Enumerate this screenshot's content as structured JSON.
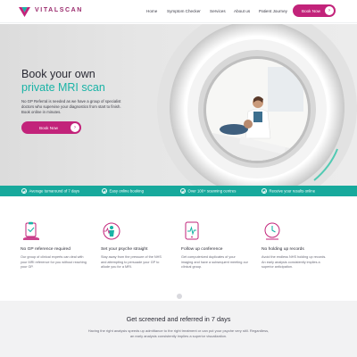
{
  "brand": {
    "name": "VITALSCAN"
  },
  "nav": {
    "items": [
      "Home",
      "Symptom Checker",
      "Services",
      "About us",
      "Patient Journey"
    ],
    "book_label": "Book Now",
    "arrow": "›"
  },
  "hero": {
    "title_line1": "Book your own",
    "title_line2": "private MRI scan",
    "description": "No GP Referral is needed as we have a group of specialist doctors who supervise your diagnostics from start to finish. Book online in minutes.",
    "cta_label": "Book Now"
  },
  "features": [
    "Average turnaround of 7 days",
    "Easy online booking",
    "Over 100+ scanning centres",
    "Receive your results online"
  ],
  "services": [
    {
      "icon": "clipboard-checkmark-icon",
      "title": "No GP reference required",
      "text": "Our group of clinical experts can deal with your MRI reference for you without reaching your GP."
    },
    {
      "icon": "body-scan-monitor-icon",
      "title": "Set your psyche straight",
      "text": "Stay away from the pressure of the NHS and attempting to persuade your GP to allude you for a MRI."
    },
    {
      "icon": "tablet-heartbeat-icon",
      "title": "Follow up conference",
      "text": "Get computerized duplicates of your imaging and have a subsequent meeting our clinical group."
    },
    {
      "icon": "clock-no-wait-icon",
      "title": "No holding up records",
      "text": "Avoid the endless NHS holding up records. An early analysis consistently implies a superior anticipation."
    }
  ],
  "bottom": {
    "title": "Get screened and referred in 7 days",
    "text": "Having the right analysis speeds up admittance to the right treatment or can put your psyche very still. Regardless, an early analysis consistently implies a superior visualization."
  },
  "colors": {
    "brand_magenta": "#c2237a",
    "accent_teal": "#19b3a6",
    "strip_teal": "#17a99c",
    "text_dark": "#2a2a34"
  }
}
